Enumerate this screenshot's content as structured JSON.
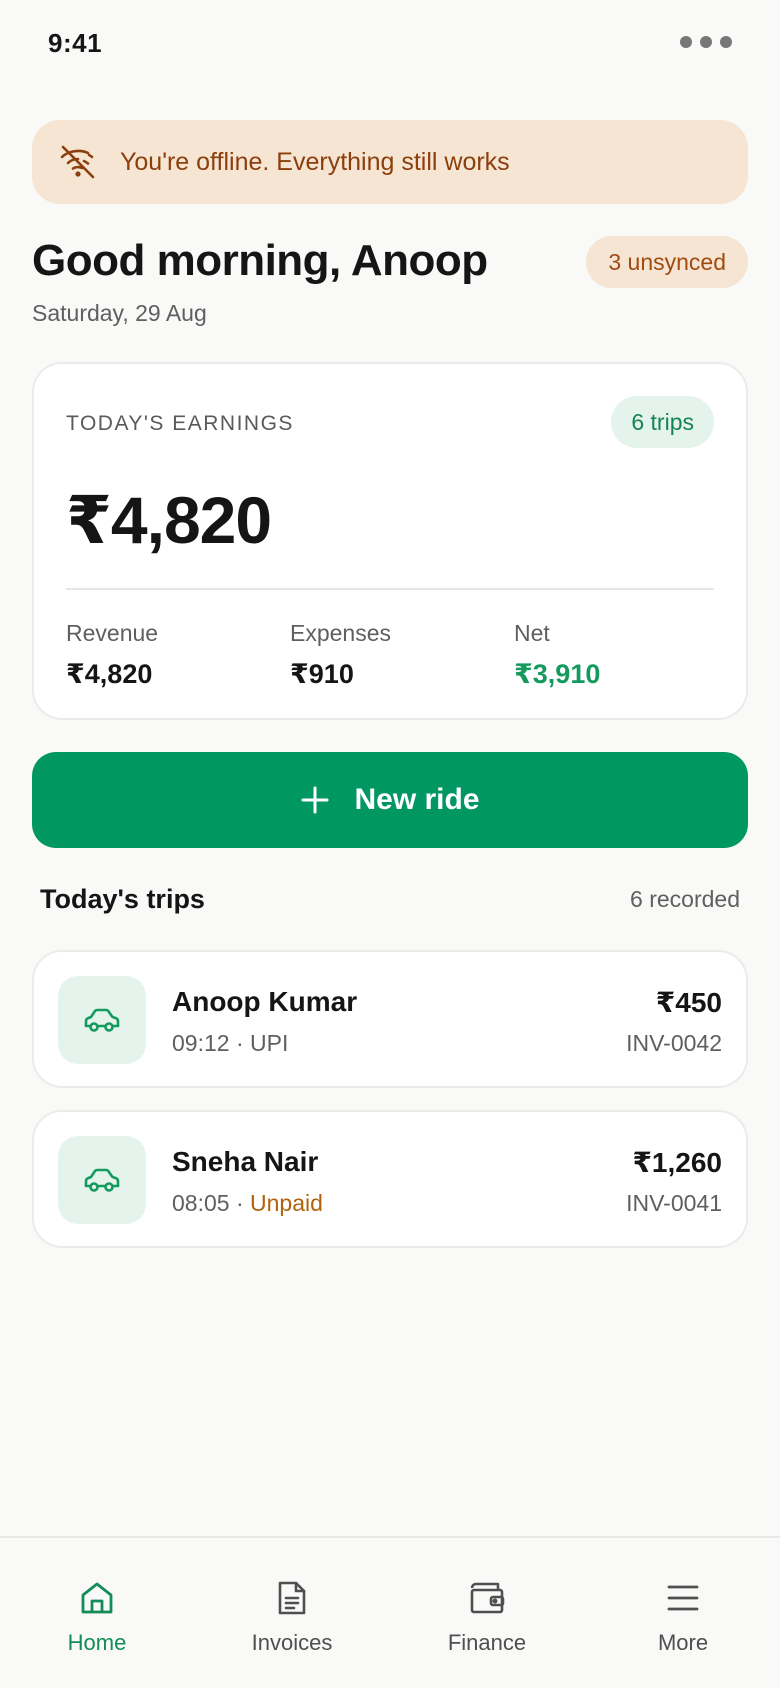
{
  "status_bar": {
    "time": "9:41"
  },
  "offline_banner": {
    "text": "You're offline. Everything still works"
  },
  "header": {
    "greeting": "Good morning, Anoop",
    "date": "Saturday, 29 Aug",
    "unsynced_badge": "3 unsynced"
  },
  "earnings_card": {
    "label": "TODAY'S EARNINGS",
    "trips_badge": "6 trips",
    "total": "₹4,820",
    "stats": [
      {
        "label": "Revenue",
        "value": "₹4,820"
      },
      {
        "label": "Expenses",
        "value": "₹910"
      },
      {
        "label": "Net",
        "value": "₹3,910"
      }
    ]
  },
  "new_ride_button": {
    "label": "New ride"
  },
  "trips_section": {
    "title": "Today's trips",
    "count": "6 recorded",
    "trips": [
      {
        "name": "Anoop Kumar",
        "time": "09:12",
        "payment": "UPI",
        "amount": "₹450",
        "invoice": "INV-0042"
      },
      {
        "name": "Sneha Nair",
        "time": "08:05",
        "payment": "Unpaid",
        "amount": "₹1,260",
        "invoice": "INV-0041"
      }
    ]
  },
  "bottom_nav": {
    "items": [
      {
        "label": "Home",
        "icon": "home-icon",
        "active": true
      },
      {
        "label": "Invoices",
        "icon": "document-icon",
        "active": false
      },
      {
        "label": "Finance",
        "icon": "wallet-icon",
        "active": false
      },
      {
        "label": "More",
        "icon": "menu-icon",
        "active": false
      }
    ]
  },
  "colors": {
    "accent": "#009763",
    "offline_bg": "#f6e5d3",
    "offline_text": "#8a3f0c",
    "unpaid": "#b2620d",
    "positive": "#159a5e"
  }
}
